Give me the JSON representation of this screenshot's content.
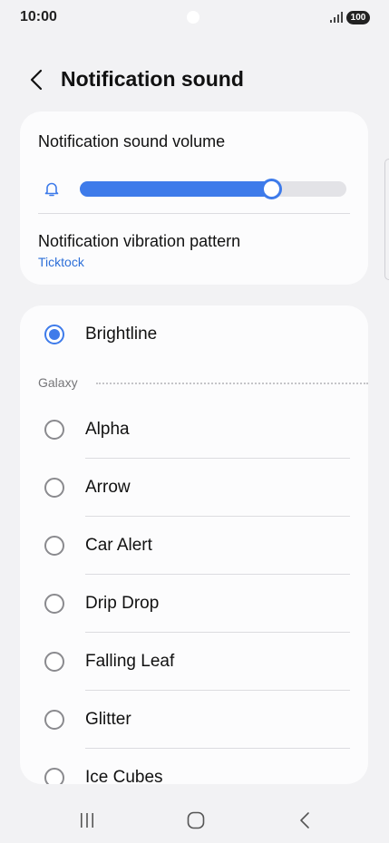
{
  "status_bar": {
    "time": "10:00",
    "battery": "100"
  },
  "header": {
    "title": "Notification sound"
  },
  "volume_card": {
    "volume_label": "Notification sound volume",
    "volume_level": 0.72,
    "vibration_label": "Notification vibration pattern",
    "vibration_value": "Ticktock"
  },
  "sound_list": {
    "selected": "Brightline",
    "section_label": "Galaxy",
    "items": [
      "Alpha",
      "Arrow",
      "Car Alert",
      "Drip Drop",
      "Falling Leaf",
      "Glitter",
      "Ice Cubes"
    ]
  },
  "colors": {
    "accent": "#3e7bea",
    "background": "#f2f2f4",
    "card": "#fcfcfd",
    "link": "#2d6fd8"
  }
}
